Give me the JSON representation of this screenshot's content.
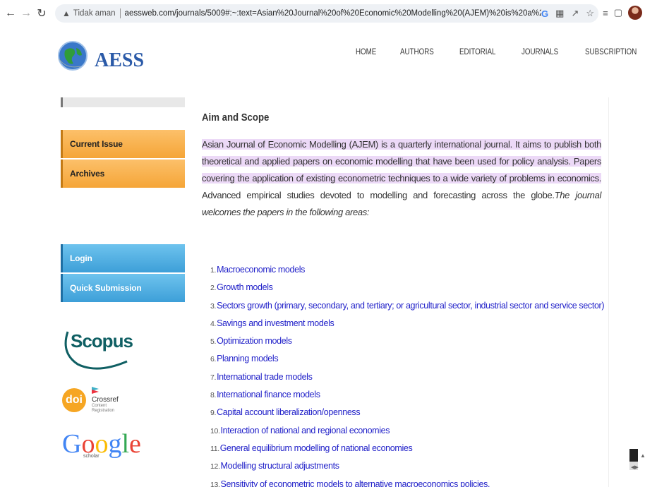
{
  "browser": {
    "security_label": "Tidak aman",
    "url": "aessweb.com/journals/5009#:~:text=Asian%20Journal%20of%20Economic%20Modelling%20(AJEM)%20is%20a%20quarterly%20internati..."
  },
  "site": {
    "logo_text": "AESS",
    "nav": [
      "HOME",
      "AUTHORS",
      "EDITORIAL",
      "JOURNALS",
      "SUBSCRIPTION"
    ]
  },
  "sidebar": {
    "current_issue": "Current Issue",
    "archives": "Archives",
    "login": "Login",
    "quick_submission": "Quick Submission",
    "scopus": "Scopus",
    "doi": "doi",
    "crossref_title": "Crossref",
    "crossref_sub1": "Content",
    "crossref_sub2": "Registration",
    "google_scholar_label": "scholar"
  },
  "main": {
    "title": "Aim and Scope",
    "para_highlight": "Asian Journal of Economic Modelling (AJEM) is a quarterly international journal. It aims to publish both theoretical and applied papers on economic modelling that have been used for policy analysis. Papers covering the application of existing econometric techniques to a wide variety of problems in economics.",
    "para_plain": " Advanced empirical studies devoted to modelling and forecasting across the globe.",
    "para_italic": "The journal welcomes the papers in the following areas:",
    "areas": [
      "Macroeconomic models",
      "Growth models",
      "Sectors growth (primary, secondary, and tertiary; or agricultural sector, industrial sector and service sector)",
      "Savings and investment models",
      "Optimization models",
      "Planning models",
      "International trade models",
      "International finance models",
      "Capital account liberalization/openness",
      "Interaction of national and regional economies",
      "General equilibrium modelling of national economies",
      "Modelling structural adjustments",
      "Sensitivity of econometric models to alternative macroeconomics policies."
    ],
    "area_numbers": [
      "1.",
      "2.",
      "3.",
      "4.",
      "5.",
      "6.",
      "7.",
      "8.",
      "9.",
      "10.",
      "11.",
      "12.",
      "13."
    ]
  }
}
